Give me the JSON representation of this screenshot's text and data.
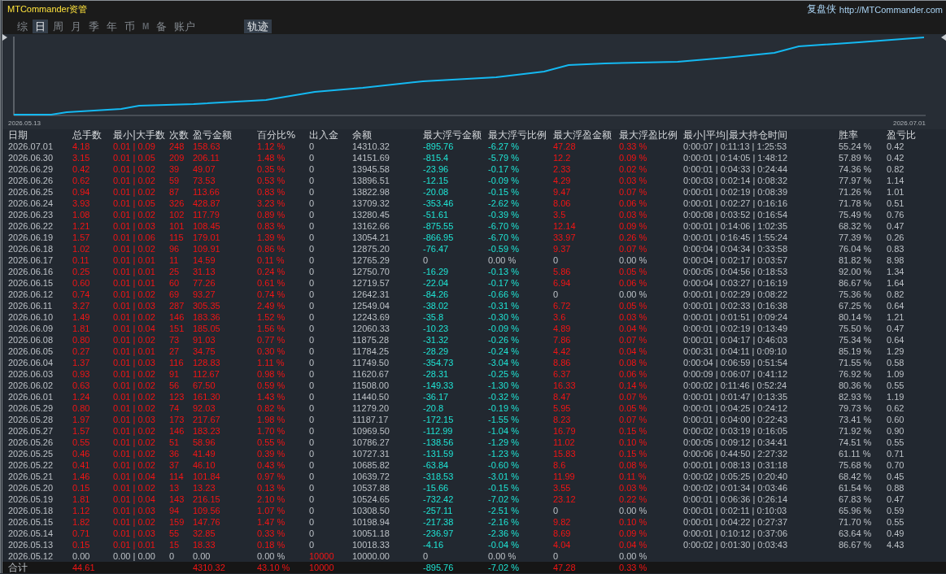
{
  "window": {
    "title": "MTCommander资管",
    "brand": "复盘侠",
    "link": "http://MTCommander.com"
  },
  "tabs": [
    {
      "label": "综",
      "selected": false,
      "disabled": false
    },
    {
      "label": "日",
      "selected": true,
      "disabled": false
    },
    {
      "label": "周",
      "selected": false,
      "disabled": false
    },
    {
      "label": "月",
      "selected": false,
      "disabled": false
    },
    {
      "label": "季",
      "selected": false,
      "disabled": false
    },
    {
      "label": "年",
      "selected": false,
      "disabled": false
    },
    {
      "label": "币",
      "selected": false,
      "disabled": false
    },
    {
      "label": "M",
      "selected": false,
      "disabled": true
    },
    {
      "label": "备",
      "selected": false,
      "disabled": false
    },
    {
      "label": "账户",
      "selected": false,
      "disabled": false
    }
  ],
  "trail_toggle": {
    "label": "轨迹",
    "on": true
  },
  "chart": {
    "start_label": "2026.05.13",
    "end_label": "2026.07.01"
  },
  "table": {
    "columns": [
      "日期",
      "总手数",
      "最小|大手数",
      "次数",
      "盈亏金额",
      "百分比%",
      "出入金",
      "余额",
      "最大浮亏金额",
      "最大浮亏比例",
      "最大浮盈金额",
      "最大浮盈比例",
      "最小|平均|最大持仓时间",
      "胜率",
      "盈亏比"
    ],
    "rows": [
      {
        "cells": [
          "2026.07.01",
          "4.18",
          "0.01 | 0.09",
          "248",
          "158.63",
          "1.12 %",
          "0",
          "14310.32",
          "-895.76",
          "-6.27 %",
          "47.28",
          "0.33 %",
          "0:00:07 | 0:11:13 | 1:25:53",
          "55.24 %",
          "0.42"
        ],
        "traded": true,
        "deposit": false,
        "float_loss": true,
        "float_gain": true
      },
      {
        "cells": [
          "2026.06.30",
          "3.15",
          "0.01 | 0.05",
          "209",
          "206.11",
          "1.48 %",
          "0",
          "14151.69",
          "-815.4",
          "-5.79 %",
          "12.2",
          "0.09 %",
          "0:00:01 | 0:14:05 | 1:48:12",
          "57.89 %",
          "0.42"
        ],
        "traded": true,
        "deposit": false,
        "float_loss": true,
        "float_gain": true
      },
      {
        "cells": [
          "2026.06.29",
          "0.42",
          "0.01 | 0.02",
          "39",
          "49.07",
          "0.35 %",
          "0",
          "13945.58",
          "-23.96",
          "-0.17 %",
          "2.33",
          "0.02 %",
          "0:00:01 | 0:04:33 | 0:24:44",
          "74.36 %",
          "0.82"
        ],
        "traded": true,
        "deposit": false,
        "float_loss": true,
        "float_gain": true
      },
      {
        "cells": [
          "2026.06.26",
          "0.62",
          "0.01 | 0.02",
          "59",
          "73.53",
          "0.53 %",
          "0",
          "13896.51",
          "-12.15",
          "-0.09 %",
          "4.29",
          "0.03 %",
          "0:00:03 | 0:02:14 | 0:08:32",
          "77.97 %",
          "1.14"
        ],
        "traded": true,
        "deposit": false,
        "float_loss": true,
        "float_gain": true
      },
      {
        "cells": [
          "2026.06.25",
          "0.94",
          "0.01 | 0.02",
          "87",
          "113.66",
          "0.83 %",
          "0",
          "13822.98",
          "-20.08",
          "-0.15 %",
          "9.47",
          "0.07 %",
          "0:00:01 | 0:02:19 | 0:08:39",
          "71.26 %",
          "1.01"
        ],
        "traded": true,
        "deposit": false,
        "float_loss": true,
        "float_gain": true
      },
      {
        "cells": [
          "2026.06.24",
          "3.93",
          "0.01 | 0.05",
          "326",
          "428.87",
          "3.23 %",
          "0",
          "13709.32",
          "-353.46",
          "-2.62 %",
          "8.06",
          "0.06 %",
          "0:00:01 | 0:02:27 | 0:16:16",
          "71.78 %",
          "0.51"
        ],
        "traded": true,
        "deposit": false,
        "float_loss": true,
        "float_gain": true
      },
      {
        "cells": [
          "2026.06.23",
          "1.08",
          "0.01 | 0.02",
          "102",
          "117.79",
          "0.89 %",
          "0",
          "13280.45",
          "-51.61",
          "-0.39 %",
          "3.5",
          "0.03 %",
          "0:00:08 | 0:03:52 | 0:16:54",
          "75.49 %",
          "0.76"
        ],
        "traded": true,
        "deposit": false,
        "float_loss": true,
        "float_gain": true
      },
      {
        "cells": [
          "2026.06.22",
          "1.21",
          "0.01 | 0.03",
          "101",
          "108.45",
          "0.83 %",
          "0",
          "13162.66",
          "-875.55",
          "-6.70 %",
          "12.14",
          "0.09 %",
          "0:00:01 | 0:14:06 | 1:02:35",
          "68.32 %",
          "0.47"
        ],
        "traded": true,
        "deposit": false,
        "float_loss": true,
        "float_gain": true
      },
      {
        "cells": [
          "2026.06.19",
          "1.57",
          "0.01 | 0.06",
          "115",
          "179.01",
          "1.39 %",
          "0",
          "13054.21",
          "-866.95",
          "-6.70 %",
          "33.97",
          "0.26 %",
          "0:00:01 | 0:16:45 | 1:55:24",
          "77.39 %",
          "0.26"
        ],
        "traded": true,
        "deposit": false,
        "float_loss": true,
        "float_gain": true
      },
      {
        "cells": [
          "2026.06.18",
          "1.02",
          "0.01 | 0.02",
          "96",
          "109.91",
          "0.86 %",
          "0",
          "12875.20",
          "-76.47",
          "-0.59 %",
          "9.37",
          "0.07 %",
          "0:00:04 | 0:04:34 | 0:33:58",
          "76.04 %",
          "0.83"
        ],
        "traded": true,
        "deposit": false,
        "float_loss": true,
        "float_gain": true
      },
      {
        "cells": [
          "2026.06.17",
          "0.11",
          "0.01 | 0.01",
          "11",
          "14.59",
          "0.11 %",
          "0",
          "12765.29",
          "0",
          "0.00 %",
          "0",
          "0.00 %",
          "0:00:04 | 0:02:17 | 0:03:57",
          "81.82 %",
          "8.98"
        ],
        "traded": true,
        "deposit": false,
        "float_loss": false,
        "float_gain": false
      },
      {
        "cells": [
          "2026.06.16",
          "0.25",
          "0.01 | 0.01",
          "25",
          "31.13",
          "0.24 %",
          "0",
          "12750.70",
          "-16.29",
          "-0.13 %",
          "5.86",
          "0.05 %",
          "0:00:05 | 0:04:56 | 0:18:53",
          "92.00 %",
          "1.34"
        ],
        "traded": true,
        "deposit": false,
        "float_loss": true,
        "float_gain": true
      },
      {
        "cells": [
          "2026.06.15",
          "0.60",
          "0.01 | 0.01",
          "60",
          "77.26",
          "0.61 %",
          "0",
          "12719.57",
          "-22.04",
          "-0.17 %",
          "6.94",
          "0.06 %",
          "0:00:04 | 0:03:27 | 0:16:19",
          "86.67 %",
          "1.64"
        ],
        "traded": true,
        "deposit": false,
        "float_loss": true,
        "float_gain": true
      },
      {
        "cells": [
          "2026.06.12",
          "0.74",
          "0.01 | 0.02",
          "69",
          "93.27",
          "0.74 %",
          "0",
          "12642.31",
          "-84.26",
          "-0.66 %",
          "0",
          "0.00 %",
          "0:00:01 | 0:02:29 | 0:08:22",
          "75.36 %",
          "0.82"
        ],
        "traded": true,
        "deposit": false,
        "float_loss": true,
        "float_gain": false
      },
      {
        "cells": [
          "2026.06.11",
          "3.27",
          "0.01 | 0.03",
          "287",
          "305.35",
          "2.49 %",
          "0",
          "12549.04",
          "-38.02",
          "-0.31 %",
          "6.72",
          "0.05 %",
          "0:00:01 | 0:02:33 | 0:16:38",
          "67.25 %",
          "0.64"
        ],
        "traded": true,
        "deposit": false,
        "float_loss": true,
        "float_gain": true
      },
      {
        "cells": [
          "2026.06.10",
          "1.49",
          "0.01 | 0.02",
          "146",
          "183.36",
          "1.52 %",
          "0",
          "12243.69",
          "-35.8",
          "-0.30 %",
          "3.6",
          "0.03 %",
          "0:00:01 | 0:01:51 | 0:09:24",
          "80.14 %",
          "1.21"
        ],
        "traded": true,
        "deposit": false,
        "float_loss": true,
        "float_gain": true
      },
      {
        "cells": [
          "2026.06.09",
          "1.81",
          "0.01 | 0.04",
          "151",
          "185.05",
          "1.56 %",
          "0",
          "12060.33",
          "-10.23",
          "-0.09 %",
          "4.89",
          "0.04 %",
          "0:00:01 | 0:02:19 | 0:13:49",
          "75.50 %",
          "0.47"
        ],
        "traded": true,
        "deposit": false,
        "float_loss": true,
        "float_gain": true
      },
      {
        "cells": [
          "2026.06.08",
          "0.80",
          "0.01 | 0.02",
          "73",
          "91.03",
          "0.77 %",
          "0",
          "11875.28",
          "-31.32",
          "-0.26 %",
          "7.86",
          "0.07 %",
          "0:00:01 | 0:04:17 | 0:46:03",
          "75.34 %",
          "0.64"
        ],
        "traded": true,
        "deposit": false,
        "float_loss": true,
        "float_gain": true
      },
      {
        "cells": [
          "2026.06.05",
          "0.27",
          "0.01 | 0.01",
          "27",
          "34.75",
          "0.30 %",
          "0",
          "11784.25",
          "-28.29",
          "-0.24 %",
          "4.42",
          "0.04 %",
          "0:00:31 | 0:04:11 | 0:09:10",
          "85.19 %",
          "1.29"
        ],
        "traded": true,
        "deposit": false,
        "float_loss": true,
        "float_gain": true
      },
      {
        "cells": [
          "2026.06.04",
          "1.37",
          "0.01 | 0.03",
          "116",
          "128.83",
          "1.11 %",
          "0",
          "11749.50",
          "-354.73",
          "-3.04 %",
          "8.86",
          "0.08 %",
          "0:00:04 | 0:06:59 | 0:51:54",
          "71.55 %",
          "0.58"
        ],
        "traded": true,
        "deposit": false,
        "float_loss": true,
        "float_gain": true
      },
      {
        "cells": [
          "2026.06.03",
          "0.93",
          "0.01 | 0.02",
          "91",
          "112.67",
          "0.98 %",
          "0",
          "11620.67",
          "-28.31",
          "-0.25 %",
          "6.37",
          "0.06 %",
          "0:00:09 | 0:06:07 | 0:41:12",
          "76.92 %",
          "1.09"
        ],
        "traded": true,
        "deposit": false,
        "float_loss": true,
        "float_gain": true
      },
      {
        "cells": [
          "2026.06.02",
          "0.63",
          "0.01 | 0.02",
          "56",
          "67.50",
          "0.59 %",
          "0",
          "11508.00",
          "-149.33",
          "-1.30 %",
          "16.33",
          "0.14 %",
          "0:00:02 | 0:11:46 | 0:52:24",
          "80.36 %",
          "0.55"
        ],
        "traded": true,
        "deposit": false,
        "float_loss": true,
        "float_gain": true
      },
      {
        "cells": [
          "2026.06.01",
          "1.24",
          "0.01 | 0.02",
          "123",
          "161.30",
          "1.43 %",
          "0",
          "11440.50",
          "-36.17",
          "-0.32 %",
          "8.47",
          "0.07 %",
          "0:00:01 | 0:01:47 | 0:13:35",
          "82.93 %",
          "1.19"
        ],
        "traded": true,
        "deposit": false,
        "float_loss": true,
        "float_gain": true
      },
      {
        "cells": [
          "2026.05.29",
          "0.80",
          "0.01 | 0.02",
          "74",
          "92.03",
          "0.82 %",
          "0",
          "11279.20",
          "-20.8",
          "-0.19 %",
          "5.95",
          "0.05 %",
          "0:00:01 | 0:04:25 | 0:24:12",
          "79.73 %",
          "0.62"
        ],
        "traded": true,
        "deposit": false,
        "float_loss": true,
        "float_gain": true
      },
      {
        "cells": [
          "2026.05.28",
          "1.97",
          "0.01 | 0.03",
          "173",
          "217.67",
          "1.98 %",
          "0",
          "11187.17",
          "-172.15",
          "-1.55 %",
          "8.23",
          "0.07 %",
          "0:00:01 | 0:04:00 | 0:22:43",
          "73.41 %",
          "0.60"
        ],
        "traded": true,
        "deposit": false,
        "float_loss": true,
        "float_gain": true
      },
      {
        "cells": [
          "2026.05.27",
          "1.57",
          "0.01 | 0.02",
          "146",
          "183.23",
          "1.70 %",
          "0",
          "10969.50",
          "-112.99",
          "-1.04 %",
          "16.79",
          "0.15 %",
          "0:00:02 | 0:03:19 | 0:16:05",
          "71.92 %",
          "0.90"
        ],
        "traded": true,
        "deposit": false,
        "float_loss": true,
        "float_gain": true
      },
      {
        "cells": [
          "2026.05.26",
          "0.55",
          "0.01 | 0.02",
          "51",
          "58.96",
          "0.55 %",
          "0",
          "10786.27",
          "-138.56",
          "-1.29 %",
          "11.02",
          "0.10 %",
          "0:00:05 | 0:09:12 | 0:34:41",
          "74.51 %",
          "0.55"
        ],
        "traded": true,
        "deposit": false,
        "float_loss": true,
        "float_gain": true
      },
      {
        "cells": [
          "2026.05.25",
          "0.46",
          "0.01 | 0.02",
          "36",
          "41.49",
          "0.39 %",
          "0",
          "10727.31",
          "-131.59",
          "-1.23 %",
          "15.83",
          "0.15 %",
          "0:00:06 | 0:44:50 | 2:27:32",
          "61.11 %",
          "0.71"
        ],
        "traded": true,
        "deposit": false,
        "float_loss": true,
        "float_gain": true
      },
      {
        "cells": [
          "2026.05.22",
          "0.41",
          "0.01 | 0.02",
          "37",
          "46.10",
          "0.43 %",
          "0",
          "10685.82",
          "-63.84",
          "-0.60 %",
          "8.6",
          "0.08 %",
          "0:00:01 | 0:08:13 | 0:31:18",
          "75.68 %",
          "0.70"
        ],
        "traded": true,
        "deposit": false,
        "float_loss": true,
        "float_gain": true
      },
      {
        "cells": [
          "2026.05.21",
          "1.46",
          "0.01 | 0.04",
          "114",
          "101.84",
          "0.97 %",
          "0",
          "10639.72",
          "-318.53",
          "-3.01 %",
          "11.99",
          "0.11 %",
          "0:00:02 | 0:05:25 | 0:20:40",
          "68.42 %",
          "0.45"
        ],
        "traded": true,
        "deposit": false,
        "float_loss": true,
        "float_gain": true
      },
      {
        "cells": [
          "2026.05.20",
          "0.15",
          "0.01 | 0.02",
          "13",
          "13.23",
          "0.13 %",
          "0",
          "10537.88",
          "-15.66",
          "-0.15 %",
          "3.55",
          "0.03 %",
          "0:00:02 | 0:01:34 | 0:03:46",
          "61.54 %",
          "0.88"
        ],
        "traded": true,
        "deposit": false,
        "float_loss": true,
        "float_gain": true
      },
      {
        "cells": [
          "2026.05.19",
          "1.81",
          "0.01 | 0.04",
          "143",
          "216.15",
          "2.10 %",
          "0",
          "10524.65",
          "-732.42",
          "-7.02 %",
          "23.12",
          "0.22 %",
          "0:00:01 | 0:06:36 | 0:26:14",
          "67.83 %",
          "0.47"
        ],
        "traded": true,
        "deposit": false,
        "float_loss": true,
        "float_gain": true
      },
      {
        "cells": [
          "2026.05.18",
          "1.12",
          "0.01 | 0.03",
          "94",
          "109.56",
          "1.07 %",
          "0",
          "10308.50",
          "-257.11",
          "-2.51 %",
          "0",
          "0.00 %",
          "0:00:01 | 0:02:11 | 0:10:03",
          "65.96 %",
          "0.59"
        ],
        "traded": true,
        "deposit": false,
        "float_loss": true,
        "float_gain": false
      },
      {
        "cells": [
          "2026.05.15",
          "1.82",
          "0.01 | 0.02",
          "159",
          "147.76",
          "1.47 %",
          "0",
          "10198.94",
          "-217.38",
          "-2.16 %",
          "9.82",
          "0.10 %",
          "0:00:01 | 0:04:22 | 0:27:37",
          "71.70 %",
          "0.55"
        ],
        "traded": true,
        "deposit": false,
        "float_loss": true,
        "float_gain": true
      },
      {
        "cells": [
          "2026.05.14",
          "0.71",
          "0.01 | 0.03",
          "55",
          "32.85",
          "0.33 %",
          "0",
          "10051.18",
          "-236.97",
          "-2.36 %",
          "8.69",
          "0.09 %",
          "0:00:01 | 0:10:12 | 0:37:06",
          "63.64 %",
          "0.49"
        ],
        "traded": true,
        "deposit": false,
        "float_loss": true,
        "float_gain": true
      },
      {
        "cells": [
          "2026.05.13",
          "0.15",
          "0.01 | 0.01",
          "15",
          "18.33",
          "0.18 %",
          "0",
          "10018.33",
          "-4.16",
          "-0.04 %",
          "4.04",
          "0.04 %",
          "0:00:02 | 0:01:30 | 0:03:43",
          "86.67 %",
          "4.43"
        ],
        "traded": true,
        "deposit": false,
        "float_loss": true,
        "float_gain": true
      },
      {
        "cells": [
          "2026.05.12",
          "0.00",
          "0.00 | 0.00",
          "0",
          "0.00",
          "0.00 %",
          "10000",
          "10000.00",
          "0",
          "0.00 %",
          "0",
          "0.00 %"
        ],
        "traded": false,
        "deposit": true,
        "float_loss": false,
        "float_gain": false
      }
    ],
    "totals": {
      "label": "合计",
      "lots": "44.61",
      "pnl": "4310.32",
      "percent": "43.10 %",
      "deposit": "10000",
      "max_float_loss": "-895.76",
      "max_float_loss_pct": "-7.02 %",
      "max_float_gain": "47.28",
      "max_float_gain_pct": "0.33 %"
    }
  }
}
